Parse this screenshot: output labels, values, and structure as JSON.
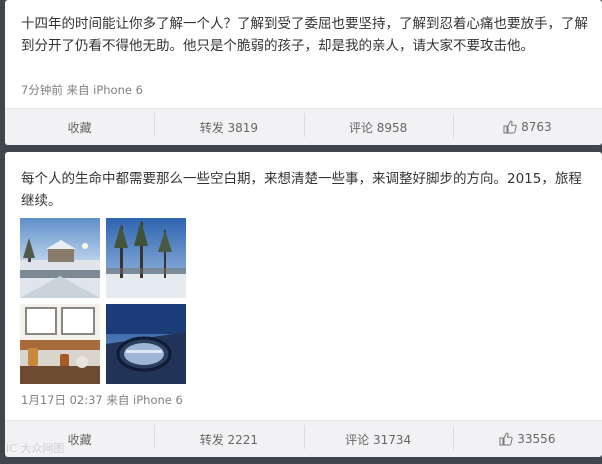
{
  "posts": [
    {
      "text": "十四年的时间能让你多了解一个人？了解到受了委屈也要坚持，了解到忍着心痛也要放手，了解到分开了仍看不得他无助。他只是个脆弱的孩子，却是我的亲人，请大家不要攻击他。",
      "meta": "7分钟前 来自 iPhone 6",
      "actions": {
        "collect": "收藏",
        "repost": "转发 3819",
        "comment": "评论 8958",
        "like": "8763"
      }
    },
    {
      "text": "每个人的生命中都需要那么一些空白期，来想清楚一些事，来调整好脚步的方向。2015，旅程继续。",
      "meta": "1月17日 02:37 来自 iPhone 6",
      "actions": {
        "collect": "收藏",
        "repost": "转发 2221",
        "comment": "评论 31734",
        "like": "33556"
      }
    }
  ],
  "watermark": "IC 大众网图",
  "icons": {
    "like": "thumbs-up-icon"
  },
  "colors": {
    "page_bg": "#40464e",
    "card_bg": "#ffffff",
    "action_bar": "#f2f2f5",
    "meta_text": "#808080"
  }
}
